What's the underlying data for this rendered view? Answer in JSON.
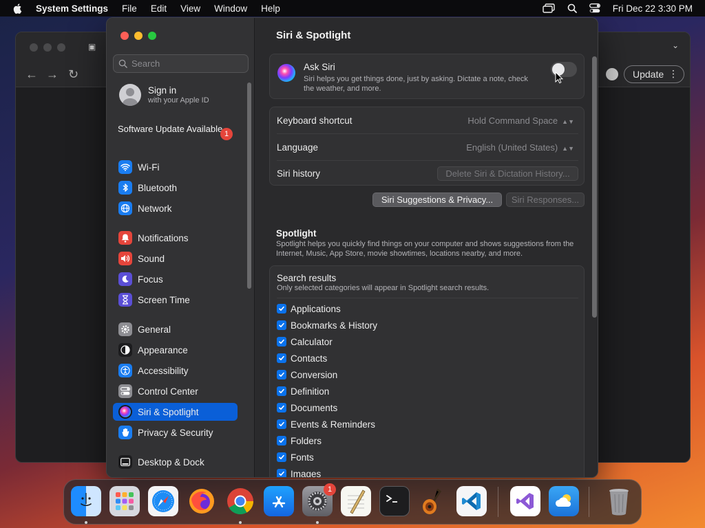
{
  "menubar": {
    "app_name": "System Settings",
    "menus": [
      "File",
      "Edit",
      "View",
      "Window",
      "Help"
    ],
    "datetime": "Fri Dec 22  3:30 PM"
  },
  "browser": {
    "update_label": "Update"
  },
  "sidebar": {
    "search_placeholder": "Search",
    "signin_title": "Sign in",
    "signin_subtitle": "with your Apple ID",
    "software_update": "Software Update Available",
    "software_update_badge": "1",
    "items": [
      {
        "label": "Wi-Fi",
        "icon": "wifi-icon",
        "color": "#1a7df1"
      },
      {
        "label": "Bluetooth",
        "icon": "bluetooth-icon",
        "color": "#1a7df1"
      },
      {
        "label": "Network",
        "icon": "globe-icon",
        "color": "#1a7df1"
      },
      {
        "label": "Notifications",
        "icon": "bell-icon",
        "color": "#e5453b"
      },
      {
        "label": "Sound",
        "icon": "speaker-icon",
        "color": "#e5453b"
      },
      {
        "label": "Focus",
        "icon": "moon-icon",
        "color": "#5b4fd6"
      },
      {
        "label": "Screen Time",
        "icon": "hourglass-icon",
        "color": "#5b4fd6"
      },
      {
        "label": "General",
        "icon": "gear-icon",
        "color": "#8e8e93"
      },
      {
        "label": "Appearance",
        "icon": "appearance-icon",
        "color": "#1c1c1e"
      },
      {
        "label": "Accessibility",
        "icon": "accessibility-icon",
        "color": "#1a7df1"
      },
      {
        "label": "Control Center",
        "icon": "control-center-icon",
        "color": "#8e8e93"
      },
      {
        "label": "Siri & Spotlight",
        "icon": "siri-icon",
        "color": "#1c1c1e"
      },
      {
        "label": "Privacy & Security",
        "icon": "hand-icon",
        "color": "#1a7df1"
      },
      {
        "label": "Desktop & Dock",
        "icon": "dock-icon",
        "color": "#1c1c1e"
      }
    ]
  },
  "content": {
    "title": "Siri & Spotlight",
    "ask_siri": {
      "title": "Ask Siri",
      "description": "Siri helps you get things done, just by asking. Dictate a note, check the weather, and more.",
      "enabled": false
    },
    "keyboard_shortcut": {
      "label": "Keyboard shortcut",
      "value": "Hold Command Space"
    },
    "language": {
      "label": "Language",
      "value": "English (United States)"
    },
    "siri_history": {
      "label": "Siri history",
      "button": "Delete Siri & Dictation History..."
    },
    "suggestions_button": "Siri Suggestions & Privacy...",
    "responses_button": "Siri Responses...",
    "spotlight": {
      "title": "Spotlight",
      "description": "Spotlight helps you quickly find things on your computer and shows suggestions from the Internet, Music, App Store, movie showtimes, locations nearby, and more."
    },
    "search_results": {
      "title": "Search results",
      "description": "Only selected categories will appear in Spotlight search results.",
      "categories": [
        {
          "label": "Applications",
          "checked": true
        },
        {
          "label": "Bookmarks & History",
          "checked": true
        },
        {
          "label": "Calculator",
          "checked": true
        },
        {
          "label": "Contacts",
          "checked": true
        },
        {
          "label": "Conversion",
          "checked": true
        },
        {
          "label": "Definition",
          "checked": true
        },
        {
          "label": "Documents",
          "checked": true
        },
        {
          "label": "Events & Reminders",
          "checked": true
        },
        {
          "label": "Folders",
          "checked": true
        },
        {
          "label": "Fonts",
          "checked": true
        },
        {
          "label": "Images",
          "checked": true
        }
      ]
    }
  },
  "dock": {
    "apps": [
      {
        "name": "Finder",
        "icon": "finder-icon",
        "running": true
      },
      {
        "name": "Launchpad",
        "icon": "launchpad-icon",
        "running": false
      },
      {
        "name": "Safari",
        "icon": "safari-icon",
        "running": false
      },
      {
        "name": "Firefox",
        "icon": "firefox-icon",
        "running": false
      },
      {
        "name": "Chrome",
        "icon": "chrome-icon",
        "running": true
      },
      {
        "name": "App Store",
        "icon": "app-store-icon",
        "running": false
      },
      {
        "name": "System Settings",
        "icon": "system-settings-icon",
        "running": true,
        "badge": "1"
      },
      {
        "name": "TextEdit",
        "icon": "textedit-icon",
        "running": false
      },
      {
        "name": "Terminal",
        "icon": "terminal-icon",
        "running": false
      },
      {
        "name": "GarageBand",
        "icon": "garageband-icon",
        "running": false
      },
      {
        "name": "VS Code",
        "icon": "vscode-icon",
        "running": false
      },
      {
        "name": "Visual Studio",
        "icon": "visual-studio-icon",
        "running": false
      },
      {
        "name": "Weather",
        "icon": "weather-icon",
        "running": false
      },
      {
        "name": "Trash",
        "icon": "trash-icon",
        "running": false
      }
    ]
  }
}
